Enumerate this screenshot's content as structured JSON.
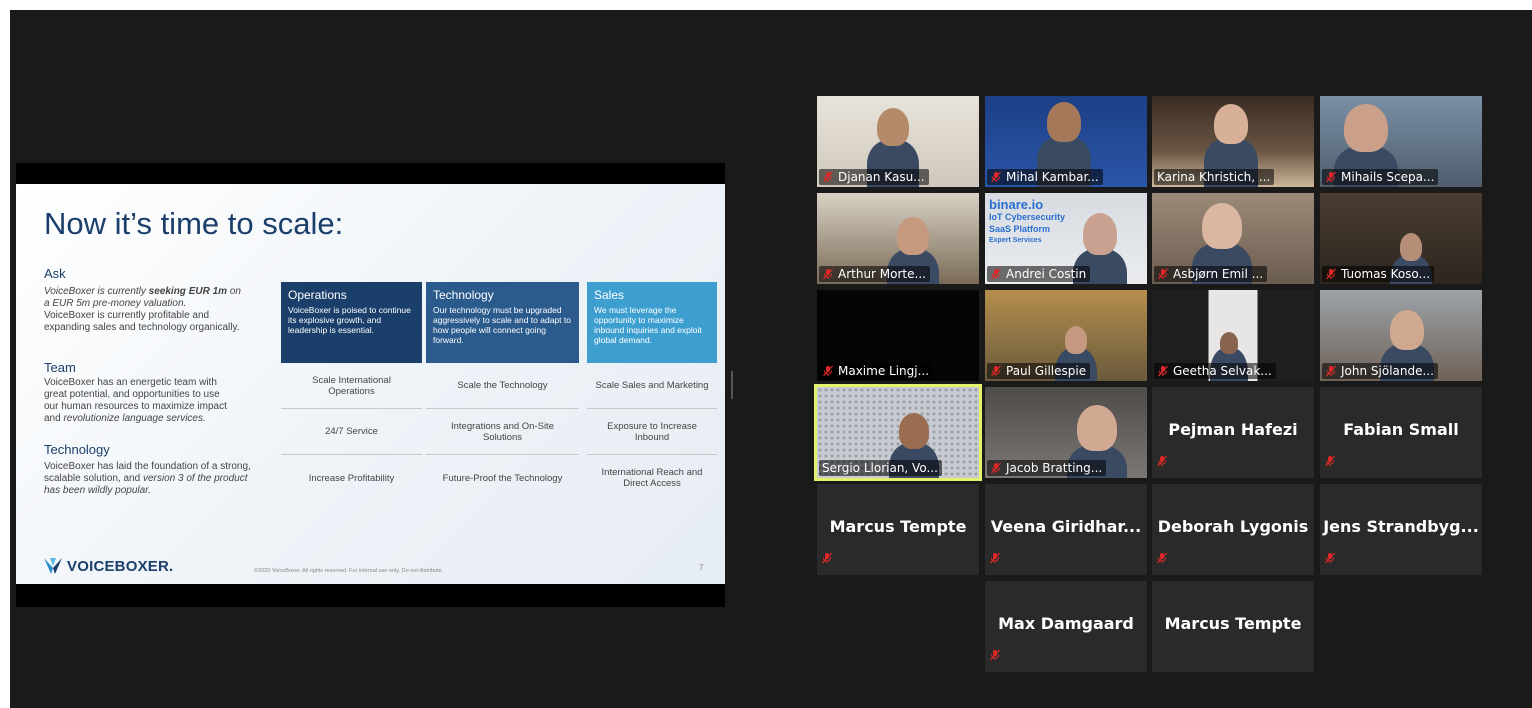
{
  "slide": {
    "title": "Now it’s time to scale:",
    "ask_heading": "Ask",
    "ask_l1": "VoiceBoxer is currently ",
    "ask_l1_b": "seeking EUR 1m",
    "ask_l1_c": " on",
    "ask_l2": "a EUR 5m pre-money valuation.",
    "ask_l3": "VoiceBoxer is currently profitable and",
    "ask_l4": "expanding sales and technology organically.",
    "team_heading": "Team",
    "team_l1": "VoiceBoxer has an energetic team with",
    "team_l2": "great potential, and opportunities to use",
    "team_l3": "our human resources to maximize impact",
    "team_l4a": "and ",
    "team_l4b": "revolutionize language services.",
    "tech_heading": "Technology",
    "tech_l1": "VoiceBoxer has laid the foundation of a strong,",
    "tech_l2a": "scalable solution, and ",
    "tech_l2b": "version 3 of the product",
    "tech_l3": "has been wildly popular.",
    "columns": [
      {
        "header": "Operations",
        "desc": "VoiceBoxer is poised to continue its explosive growth, and leadership is essential.",
        "color": "#1b3f6b",
        "cells": [
          "Scale International Operations",
          "24/7 Service",
          "Increase Profitability"
        ]
      },
      {
        "header": "Technology",
        "desc": "Our technology must be upgraded aggressively to scale and to adapt to how people will connect going forward.",
        "color": "#2b5a8c",
        "cells": [
          "Scale the Technology",
          "Integrations and On-Site Solutions",
          "Future-Proof the Technology"
        ]
      },
      {
        "header": "Sales",
        "desc": "We must leverage the opportunity to maximize inbound inquiries and exploit global demand.",
        "color": "#3d9fd0",
        "cells": [
          "Scale Sales and Marketing",
          "Exposure to Increase Inbound",
          "International Reach and Direct Access"
        ]
      }
    ],
    "logo_text": "VOICEBOXER.",
    "copyright": "©2020 VoiceBoxer. All rights reserved. For internal use only. Do not distribute.",
    "page_number": "7"
  },
  "participants": [
    {
      "name": "Djanan Kasu...",
      "muted": true
    },
    {
      "name": "Mihal Kambar...",
      "muted": true
    },
    {
      "name": "Karina Khristich, ...",
      "muted": false
    },
    {
      "name": "Mihails Scepa...",
      "muted": true
    },
    {
      "name": "Arthur Morte...",
      "muted": true
    },
    {
      "name": "Andrei Costin",
      "muted": true,
      "banner": "binare.io",
      "banner2": "IoT Cybersecurity",
      "banner3": "SaaS Platform",
      "banner4": "Expert Services"
    },
    {
      "name": "Asbjørn Emil ...",
      "muted": true
    },
    {
      "name": "Tuomas Koso...",
      "muted": true
    },
    {
      "name": "Maxime Lingj...",
      "muted": true
    },
    {
      "name": "Paul Gillespie",
      "muted": true
    },
    {
      "name": "Geetha Selvak...",
      "muted": true
    },
    {
      "name": "John Sjölande...",
      "muted": true
    },
    {
      "name": "Sergio Llorian, Vo...",
      "muted": false,
      "active": true
    },
    {
      "name": "Jacob Bratting...",
      "muted": true
    },
    {
      "name": "Pejman Hafezi",
      "muted": true,
      "avatar": true
    },
    {
      "name": "Fabian Small",
      "muted": true,
      "avatar": true
    },
    {
      "name": "Marcus Tempte",
      "muted": true,
      "avatar": true
    },
    {
      "name": "Veena Giridhar...",
      "muted": true,
      "avatar": true
    },
    {
      "name": "Deborah Lygonis",
      "muted": true,
      "avatar": true
    },
    {
      "name": "Jens Strandbyg...",
      "muted": true,
      "avatar": true
    },
    {
      "name": "Max Damgaard",
      "muted": true,
      "avatar": true
    },
    {
      "name": "Marcus Tempte",
      "muted": false,
      "avatar": true
    }
  ],
  "colors": {
    "muted_icon": "#e02828",
    "active_border": "#e3f26a"
  }
}
